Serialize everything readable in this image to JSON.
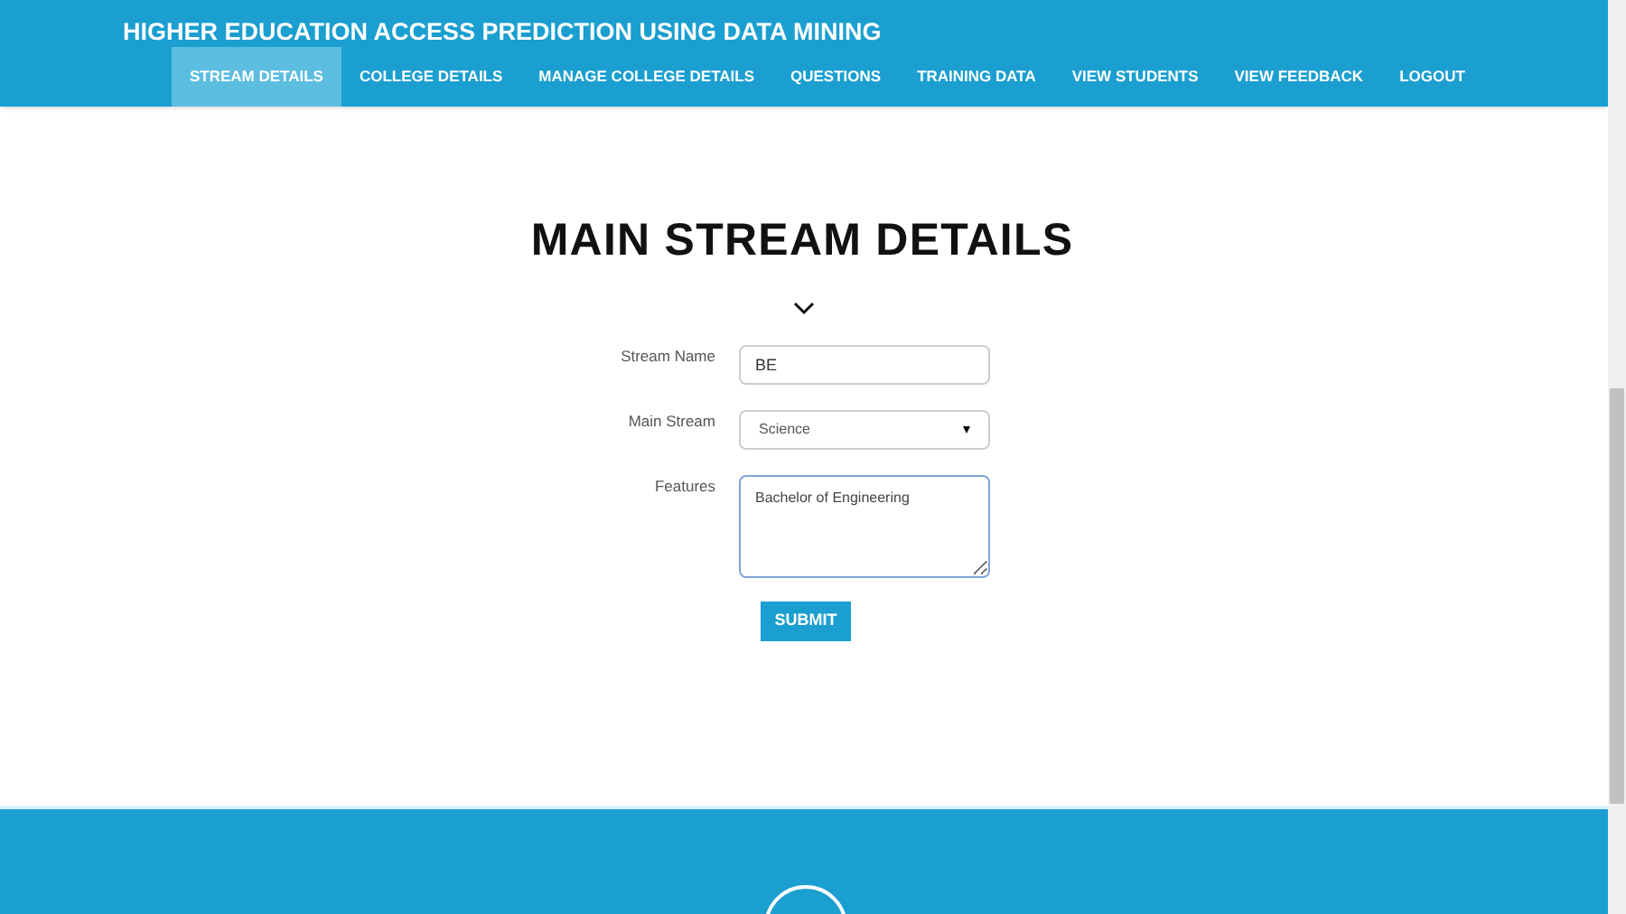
{
  "site_title": "HIGHER EDUCATION ACCESS PREDICTION USING DATA MINING",
  "nav": [
    {
      "label": "STREAM DETAILS",
      "selected": true
    },
    {
      "label": "COLLEGE DETAILS",
      "selected": false
    },
    {
      "label": "MANAGE COLLEGE DETAILS",
      "selected": false
    },
    {
      "label": "QUESTIONS",
      "selected": false
    },
    {
      "label": "TRAINING DATA",
      "selected": false
    },
    {
      "label": "VIEW STUDENTS",
      "selected": false
    },
    {
      "label": "VIEW FEEDBACK",
      "selected": false
    },
    {
      "label": "LOGOUT",
      "selected": false
    }
  ],
  "heading": "MAIN STREAM DETAILS",
  "form": [
    {
      "kind": "text",
      "label": "Stream Name",
      "value": "BE"
    },
    {
      "kind": "select",
      "label": "Main Stream",
      "value": "Science"
    },
    {
      "kind": "textarea",
      "label": "Features",
      "value": "Bachelor of Engineering"
    }
  ],
  "submit": "SUBMIT"
}
